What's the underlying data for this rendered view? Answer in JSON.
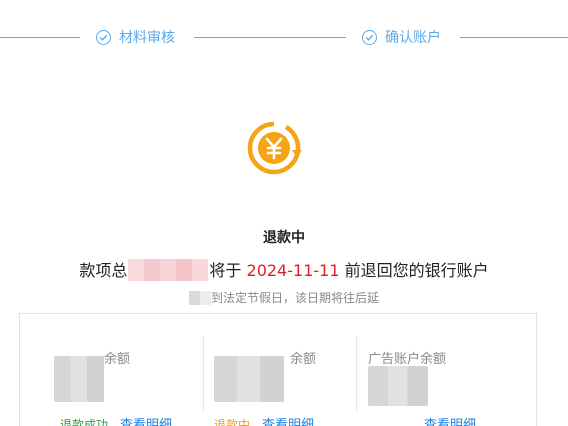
{
  "steps": [
    {
      "label": "材料审核"
    },
    {
      "label": "确认账户"
    }
  ],
  "status_title": "退款中",
  "message": {
    "prefix": "款项总",
    "mid": "将于",
    "date": "2024-11-11",
    "suffix": "前退回您的银行账户"
  },
  "note": {
    "text": "到法定节假日，该日期将往后延"
  },
  "balances": [
    {
      "label": "余额",
      "state": "退款成功",
      "state_color": "#2e9e3e",
      "detail": "查看明细"
    },
    {
      "label": "余额",
      "state": "退款中",
      "state_color": "#f0a020",
      "detail": "查看明细"
    },
    {
      "label": "广告账户余额",
      "state": "",
      "state_color": "#1f7fe0",
      "detail": "查看明细"
    }
  ],
  "colors": {
    "accent": "#5fa9e5",
    "date": "#e02020",
    "link": "#1f7fe0",
    "icon": "#f5a413"
  }
}
